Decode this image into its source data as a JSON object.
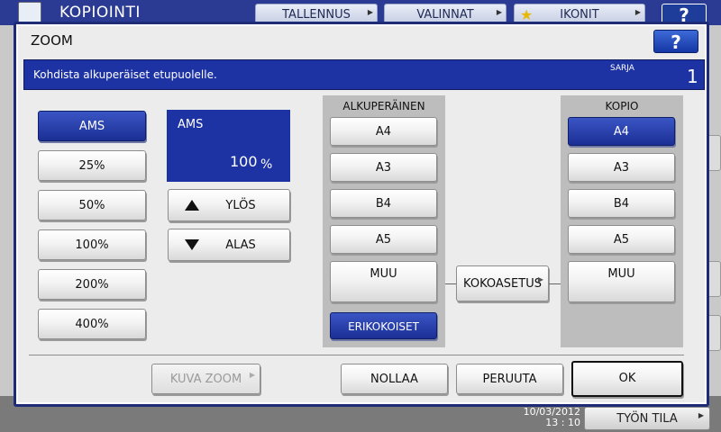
{
  "background": {
    "app_title": "KOPIOINTI",
    "tabs": [
      "TALLENNUS",
      "VALINNAT",
      "IKONIT"
    ],
    "help_label": "?",
    "time_date": "10/03/2012",
    "time_clock": "13 : 10",
    "job_status_label": "TYÖN TILA"
  },
  "dialog": {
    "title": "ZOOM",
    "help_label": "?",
    "message": "Kohdista alkuperäiset etupuolelle.",
    "sarja_label": "SARJA",
    "sarja_value": "1"
  },
  "ratio_buttons": [
    {
      "label": "AMS",
      "selected": true
    },
    {
      "label": "25%",
      "selected": false
    },
    {
      "label": "50%",
      "selected": false
    },
    {
      "label": "100%",
      "selected": false
    },
    {
      "label": "200%",
      "selected": false
    },
    {
      "label": "400%",
      "selected": false
    }
  ],
  "ams_display": {
    "label": "AMS",
    "value": "100",
    "unit": "%"
  },
  "step": {
    "up_label": "YLÖS",
    "down_label": "ALAS"
  },
  "original": {
    "header": "ALKUPERÄINEN",
    "sizes": [
      "A4",
      "A3",
      "B4",
      "A5",
      "MUU"
    ],
    "special_label": "ERIKOKOISET"
  },
  "size_setting_label": "KOKOASETUS",
  "copy": {
    "header": "KOPIO",
    "sizes": [
      "A4",
      "A3",
      "B4",
      "A5",
      "MUU"
    ],
    "selected": "A4"
  },
  "footer": {
    "image_zoom_label": "KUVA ZOOM",
    "reset_label": "NOLLAA",
    "cancel_label": "PERUUTA",
    "ok_label": "OK"
  },
  "colors": {
    "accent": "#1d33a3",
    "selected": "#1b2f95"
  }
}
